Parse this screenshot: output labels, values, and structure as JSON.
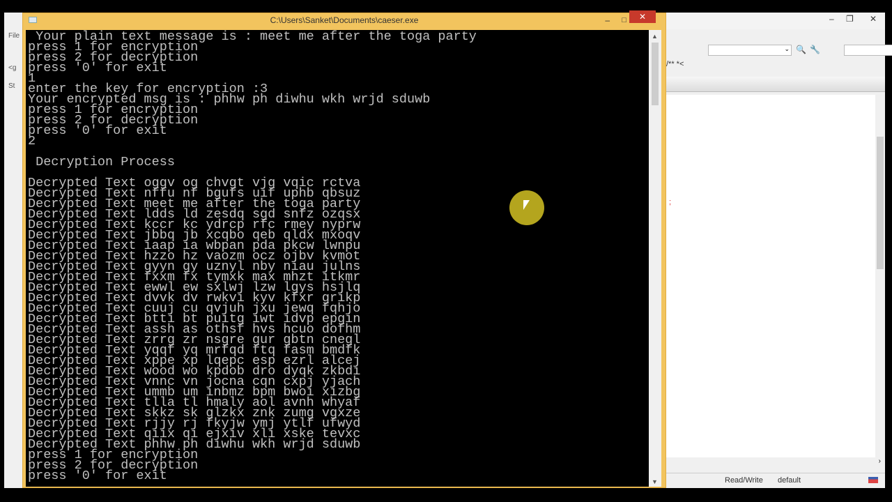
{
  "background_app": {
    "menu_file": "File",
    "tab_start": "St",
    "code_tag": "<g"
  },
  "editor": {
    "status_mode": "Read/Write",
    "status_profile": "default",
    "toolbar_text": "/** *<",
    "red_mark": ";"
  },
  "console": {
    "title": "C:\\Users\\Sanket\\Documents\\caeser.exe",
    "lines": [
      " Your plain text message is : meet me after the toga party",
      "press 1 for encryption",
      "press 2 for decryption",
      "press '0' for exit",
      "1",
      "enter the key for encryption :3",
      "Your encrypted msg is : phhw ph diwhu wkh wrjd sduwb",
      "press 1 for encryption",
      "press 2 for decryption",
      "press '0' for exit",
      "2",
      "",
      " Decryption Process",
      "",
      "Decrypted Text oggv og chvgt vjg vqic rctva",
      "Decrypted Text nffu nf bgufs uif uphb qbsuz",
      "Decrypted Text meet me after the toga party",
      "Decrypted Text ldds ld zesdq sgd snfz ozqsx",
      "Decrypted Text kccr kc ydrcp rfc rmey nyprw",
      "Decrypted Text jbbq jb xcqbo qeb qldx mxoqv",
      "Decrypted Text iaap ia wbpan pda pkcw lwnpu",
      "Decrypted Text hzzo hz vaozm ocz ojbv kvmot",
      "Decrypted Text gyyn gy uznyl nby niau julns",
      "Decrypted Text fxxm fx tymxk max mhzt itkmr",
      "Decrypted Text ewwl ew sxlwj lzw lgys hsjlq",
      "Decrypted Text dvvk dv rwkvi kyv kfxr grikp",
      "Decrypted Text cuuj cu qvjuh jxu jewq fqhjo",
      "Decrypted Text btti bt puitg iwt idvp epgin",
      "Decrypted Text assh as othsf hvs hcuo dofhm",
      "Decrypted Text zrrg zr nsgre gur gbtn cnegl",
      "Decrypted Text yqqf yq mrfqd ftq fasm bmdfk",
      "Decrypted Text xppe xp lqepc esp ezrl alcej",
      "Decrypted Text wood wo kpdob dro dyqk zkbdi",
      "Decrypted Text vnnc vn jocna cqn cxpj yjach",
      "Decrypted Text ummb um inbmz bpm bwoi xizbg",
      "Decrypted Text tlla tl hmaly aol avnh whyaf",
      "Decrypted Text skkz sk glzkx znk zumg vgxze",
      "Decrypted Text rjjy rj fkyjw ymj ytlf ufwyd",
      "Decrypted Text qiix qi ejxiv xli xske tevxc",
      "Decrypted Text phhw ph diwhu wkh wrjd sduwb",
      "press 1 for encryption",
      "press 2 for decryption",
      "press '0' for exit",
      "_"
    ]
  }
}
